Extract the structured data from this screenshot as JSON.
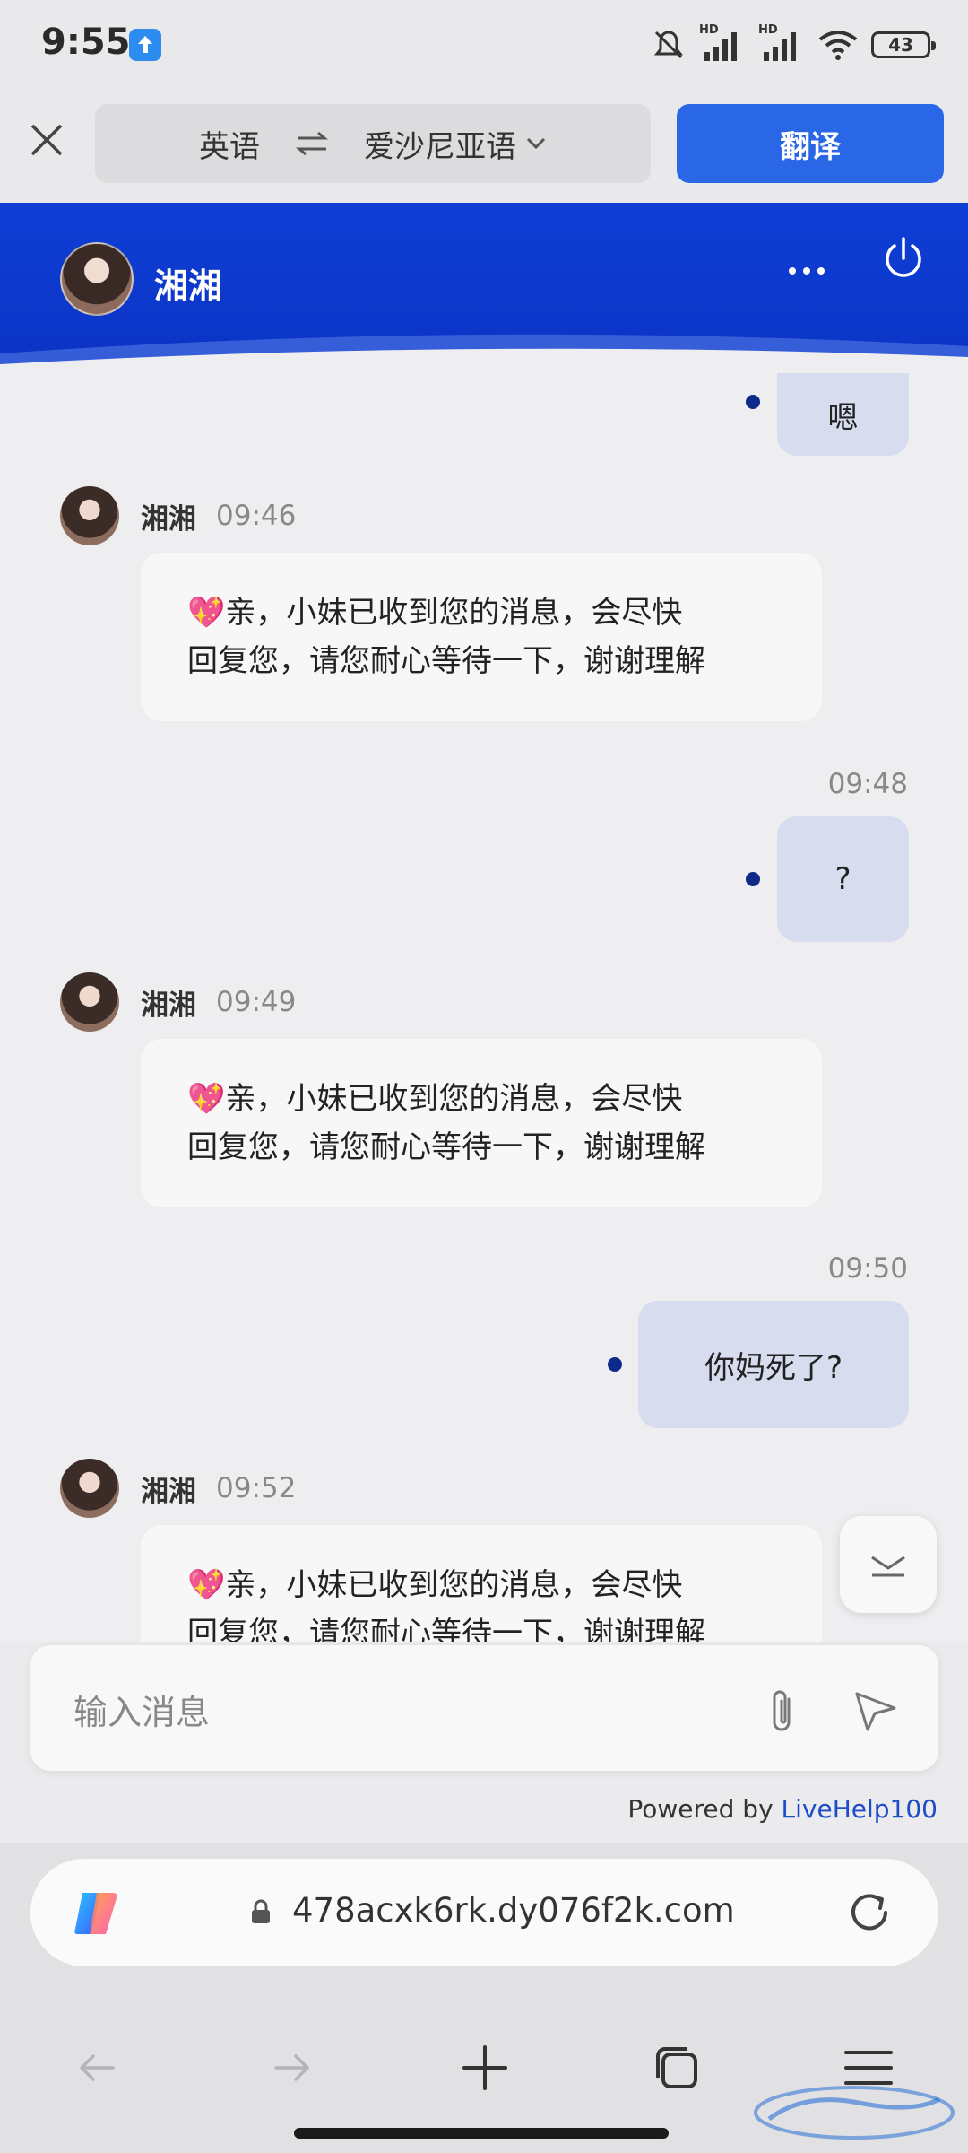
{
  "status": {
    "time": "9:55",
    "battery": "43",
    "hd1": "HD",
    "hd2": "HD"
  },
  "translate": {
    "source_lang": "英语",
    "target_lang": "爱沙尼亚语",
    "button": "翻译"
  },
  "chat": {
    "header_name": "湘湘",
    "messages": [
      {
        "type": "out",
        "text": "嗯"
      },
      {
        "type": "in",
        "sender": "湘湘",
        "time": "09:46",
        "line1": "亲，小妹已收到您的消息，会尽快",
        "line2": "回复您，请您耐心等待一下，谢谢理解"
      },
      {
        "type": "out",
        "time": "09:48",
        "text": "?"
      },
      {
        "type": "in",
        "sender": "湘湘",
        "time": "09:49",
        "line1": "亲，小妹已收到您的消息，会尽快",
        "line2": "回复您，请您耐心等待一下，谢谢理解"
      },
      {
        "type": "out",
        "time": "09:50",
        "text": "你妈死了?"
      },
      {
        "type": "in",
        "sender": "湘湘",
        "time": "09:52",
        "line1": "亲，小妹已收到您的消息，会尽快",
        "line2": "回复您，请您耐心等待一下，谢谢理解"
      }
    ],
    "heart": "💖"
  },
  "input": {
    "placeholder": "输入消息"
  },
  "powered": {
    "prefix": "Powered by ",
    "link": "LiveHelp100"
  },
  "browser": {
    "url": "478acxk6rk.dy076f2k.com"
  },
  "colors": {
    "header_blue": "#0f3fd6",
    "translate_btn": "#2967e6",
    "bubble_out": "#d7dcef",
    "dot": "#0d2a8a",
    "link": "#1f4cc7"
  },
  "icons": [
    "close-icon",
    "swap-icon",
    "chevron-down-icon",
    "more-icon",
    "power-icon",
    "attach-icon",
    "send-icon",
    "scroll-down-icon",
    "copilot-icon",
    "lock-icon",
    "reload-icon",
    "back-icon",
    "forward-icon",
    "new-tab-icon",
    "tabs-icon",
    "menu-icon"
  ]
}
